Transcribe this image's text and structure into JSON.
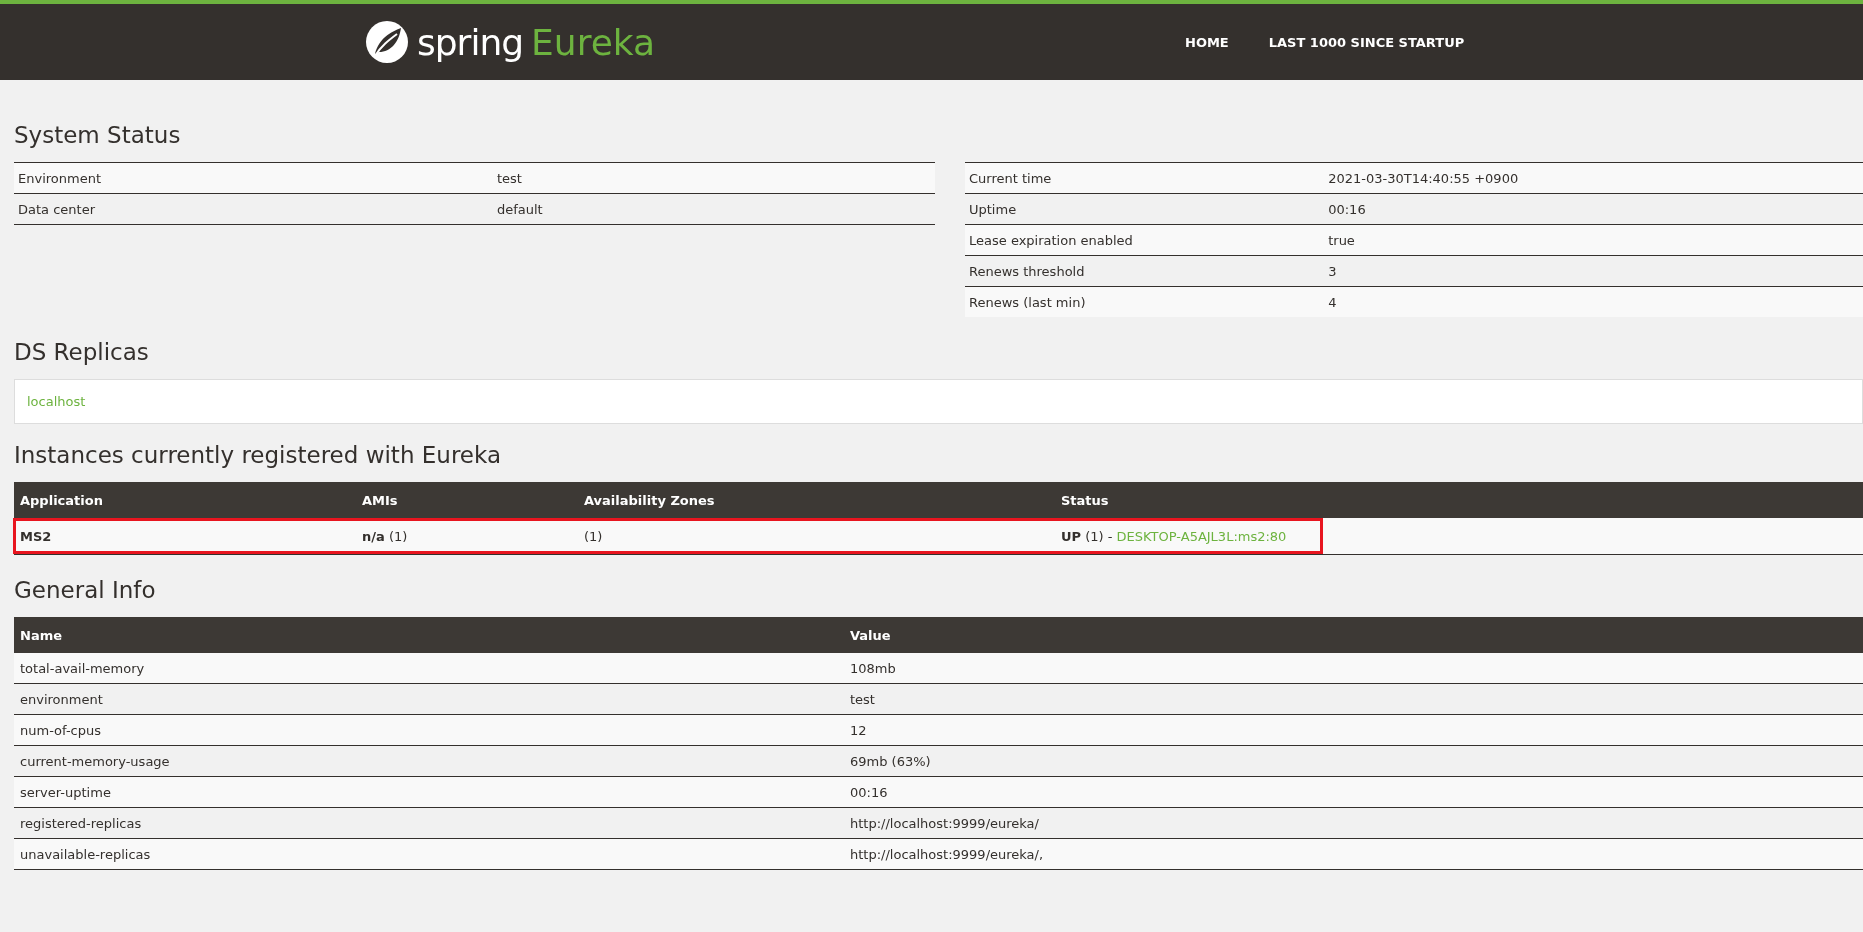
{
  "header": {
    "brand": "spring",
    "product": "Eureka",
    "nav": [
      {
        "label": "HOME"
      },
      {
        "label": "LAST 1000 SINCE STARTUP"
      }
    ]
  },
  "system_status": {
    "title": "System Status",
    "left": [
      {
        "name": "Environment",
        "value": "test"
      },
      {
        "name": "Data center",
        "value": "default"
      }
    ],
    "right": [
      {
        "name": "Current time",
        "value": "2021-03-30T14:40:55 +0900"
      },
      {
        "name": "Uptime",
        "value": "00:16"
      },
      {
        "name": "Lease expiration enabled",
        "value": "true"
      },
      {
        "name": "Renews threshold",
        "value": "3"
      },
      {
        "name": "Renews (last min)",
        "value": "4"
      }
    ]
  },
  "ds_replicas": {
    "title": "DS Replicas",
    "items": [
      "localhost"
    ]
  },
  "instances": {
    "title": "Instances currently registered with Eureka",
    "columns": [
      "Application",
      "AMIs",
      "Availability Zones",
      "Status"
    ],
    "rows": [
      {
        "application": "MS2",
        "amis": "**n/a** (1)",
        "zones": "(1)",
        "status": "**UP** (1) - ",
        "instance_link": "DESKTOP-A5AJL3L:ms2:80",
        "highlighted": true
      }
    ]
  },
  "general_info": {
    "title": "General Info",
    "columns": [
      "Name",
      "Value"
    ],
    "rows": [
      {
        "name": "total-avail-memory",
        "value": "108mb"
      },
      {
        "name": "environment",
        "value": "test"
      },
      {
        "name": "num-of-cpus",
        "value": "12"
      },
      {
        "name": "current-memory-usage",
        "value": "69mb (63%)"
      },
      {
        "name": "server-uptime",
        "value": "00:16"
      },
      {
        "name": "registered-replicas",
        "value": "http://localhost:9999/eureka/"
      },
      {
        "name": "unavailable-replicas",
        "value": "http://localhost:9999/eureka/,"
      }
    ]
  }
}
